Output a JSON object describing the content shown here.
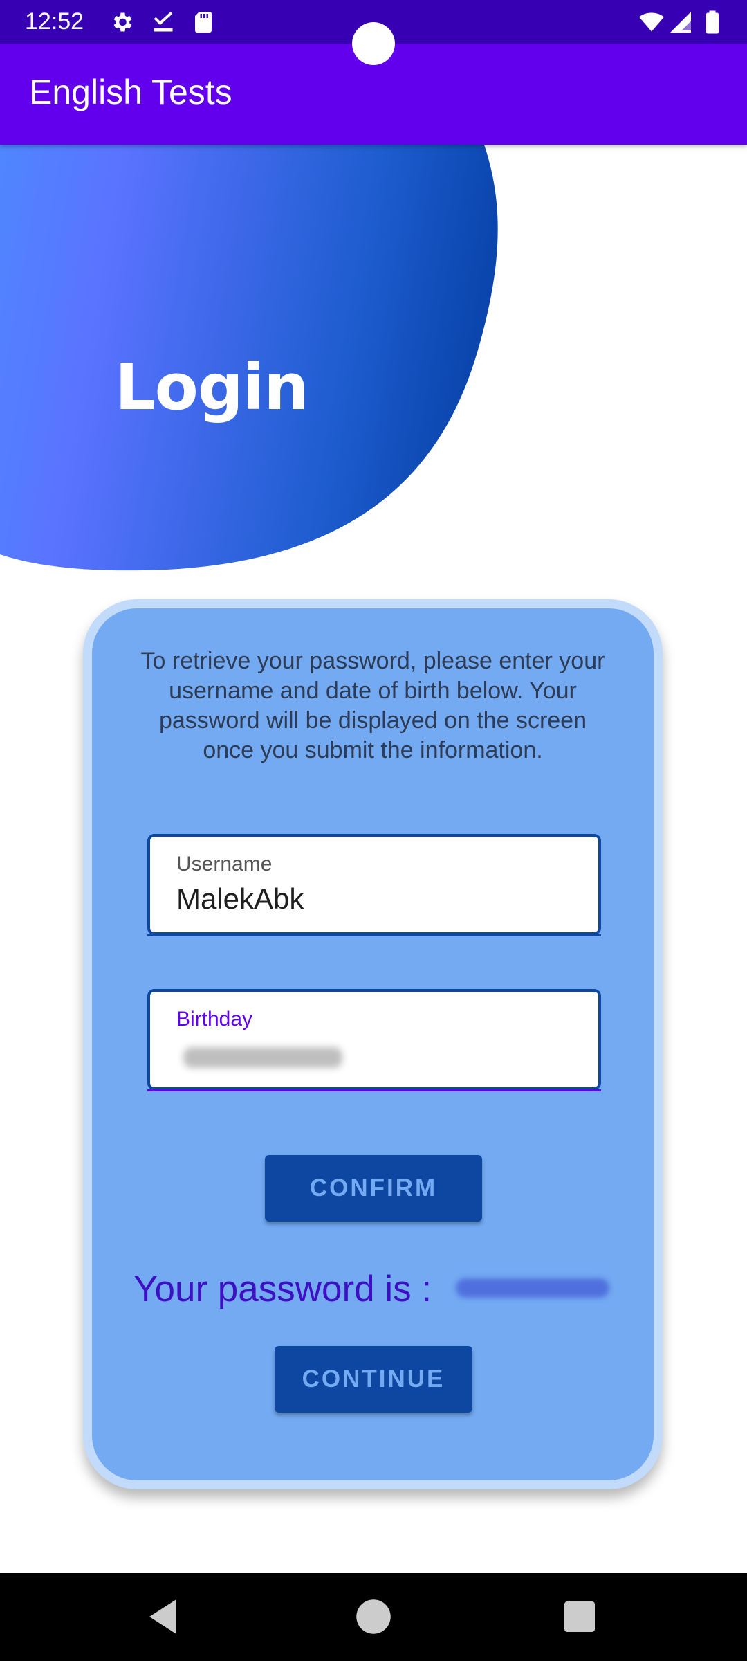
{
  "status_bar": {
    "time": "12:52",
    "left_icons": [
      "gear-icon",
      "download-check-icon",
      "sd-card-icon"
    ],
    "right_icons": [
      "wifi-icon",
      "signal-icon",
      "battery-icon"
    ]
  },
  "app_bar": {
    "title": "English Tests",
    "color": "#6200ee"
  },
  "header": {
    "title": "Login"
  },
  "card": {
    "info_text": "To retrieve your password, please enter your username and date of birth below. Your password will be displayed on the screen once you submit the information.",
    "username_field": {
      "label": "Username",
      "value": "MalekAbk"
    },
    "birthday_field": {
      "label": "Birthday",
      "value_redacted": true
    },
    "confirm_label": "CONFIRM",
    "password_label": "Your password is :",
    "password_redacted": true,
    "continue_label": "CONTINUE"
  },
  "nav_bar": {
    "buttons": [
      "back-icon",
      "home-icon",
      "recents-icon"
    ]
  },
  "colors": {
    "status_bar": "#3700b3",
    "app_bar": "#6200ee",
    "card_bg": "#73aaf2",
    "card_border": "#c3dbfb",
    "button_bg": "#0d47a1",
    "password_text": "#3d10c4",
    "focused_label": "#6200ee"
  }
}
